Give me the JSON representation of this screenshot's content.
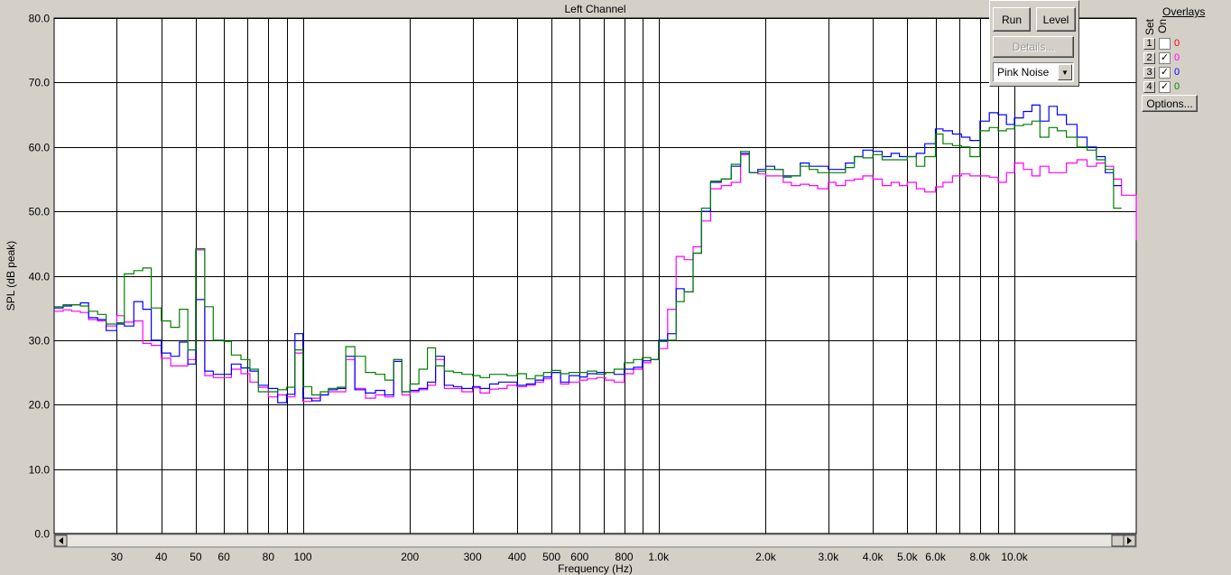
{
  "chart_data": {
    "type": "line",
    "title": "Left Channel",
    "xlabel": "Frequency (Hz)",
    "ylabel": "SPL (dB peak)",
    "x_scale": "log",
    "xlim": [
      20,
      22000
    ],
    "ylim": [
      0,
      80
    ],
    "y_ticks": [
      0,
      10,
      20,
      30,
      40,
      50,
      60,
      70,
      80
    ],
    "y_tick_labels": [
      "0.0",
      "10.0",
      "20.0",
      "30.0",
      "40.0",
      "50.0",
      "60.0",
      "70.0",
      "80.0"
    ],
    "x_ticks": [
      30,
      40,
      50,
      60,
      80,
      100,
      200,
      300,
      400,
      500,
      600,
      800,
      1000,
      2000,
      3000,
      4000,
      5000,
      6000,
      8000,
      10000
    ],
    "x_tick_labels": [
      "30",
      "40",
      "50",
      "60",
      "80",
      "100",
      "200",
      "300",
      "400",
      "500",
      "600",
      "800",
      "1.0k",
      "2.0k",
      "3.0k",
      "4.0k",
      "5.0k",
      "6.0k",
      "8.0k",
      "10.0k"
    ],
    "x_grid": [
      30,
      40,
      50,
      60,
      70,
      80,
      90,
      100,
      200,
      300,
      400,
      500,
      600,
      700,
      800,
      900,
      1000,
      2000,
      3000,
      4000,
      5000,
      6000,
      7000,
      8000,
      9000,
      10000
    ],
    "grid": true,
    "bands_hz": [
      20,
      21.2,
      22.4,
      23.7,
      25,
      26.5,
      28,
      30,
      31.5,
      33.5,
      35.5,
      37.5,
      40,
      42.5,
      45,
      47.5,
      50,
      53,
      56,
      60,
      63,
      67,
      71,
      75,
      80,
      85,
      90,
      95,
      100,
      106,
      112,
      118,
      125,
      132,
      140,
      150,
      160,
      170,
      180,
      190,
      200,
      212,
      224,
      236,
      250,
      265,
      280,
      300,
      315,
      335,
      355,
      375,
      400,
      425,
      450,
      475,
      500,
      530,
      560,
      600,
      630,
      670,
      710,
      750,
      800,
      850,
      900,
      950,
      1000,
      1060,
      1120,
      1180,
      1250,
      1320,
      1400,
      1500,
      1600,
      1700,
      1800,
      1900,
      2000,
      2120,
      2240,
      2360,
      2500,
      2650,
      2800,
      3000,
      3150,
      3350,
      3550,
      3750,
      4000,
      4250,
      4500,
      4750,
      5000,
      5300,
      5600,
      6000,
      6300,
      6700,
      7100,
      7500,
      8000,
      8500,
      9000,
      9500,
      10000,
      10600,
      11200,
      11800,
      12500,
      13200,
      14000,
      15000,
      16000,
      17000,
      18000,
      19000,
      20000,
      22000
    ],
    "series": [
      {
        "overlay": "2",
        "color": "#ff00ff",
        "values": [
          34.5,
          34.7,
          34.5,
          34.3,
          33.2,
          33,
          32.2,
          33.8,
          32.8,
          33,
          29.5,
          29.2,
          27.2,
          26,
          26,
          27,
          44,
          24.5,
          24.2,
          24.2,
          25.5,
          24.8,
          23.5,
          22.7,
          21.2,
          21.5,
          21.2,
          28,
          20.5,
          21,
          21.5,
          22,
          22,
          27,
          22.5,
          21,
          21.5,
          21.2,
          27,
          21.5,
          22,
          22.3,
          23,
          27,
          22.5,
          22.5,
          22,
          22.6,
          21.8,
          22.4,
          22.5,
          23,
          22.8,
          23,
          23.5,
          24,
          25,
          23.2,
          23.5,
          23.8,
          24,
          24.2,
          23.8,
          23.5,
          24.8,
          25.5,
          26.5,
          27,
          28.7,
          34.8,
          43,
          42.5,
          44.5,
          48.5,
          53.5,
          54,
          54.5,
          58.8,
          56,
          55.8,
          55.5,
          55.5,
          54.5,
          54,
          54.2,
          54,
          53.5,
          54.5,
          54,
          54.8,
          55,
          55.5,
          55,
          54,
          54.5,
          54,
          54.5,
          53.5,
          53,
          53.8,
          54.5,
          55.5,
          55.8,
          55.5,
          55.5,
          55.3,
          54.5,
          56,
          57.5,
          56.5,
          55.5,
          57,
          56,
          56,
          57.5,
          58,
          57,
          57.5,
          57,
          55,
          52.5,
          45.5
        ]
      },
      {
        "overlay": "3",
        "color": "#0000ff",
        "values": [
          35,
          35.3,
          35.5,
          35.8,
          33.5,
          33.2,
          31.5,
          32.5,
          32.2,
          36,
          34.8,
          30,
          28,
          27.5,
          29.7,
          26.3,
          36.3,
          25.2,
          24.7,
          24.7,
          26.3,
          25.7,
          25.2,
          23,
          22.5,
          20.3,
          21.6,
          31,
          21,
          20.6,
          21.5,
          22.3,
          22.5,
          27.5,
          22.3,
          21.8,
          22.2,
          21.5,
          26.7,
          22,
          22.2,
          22.5,
          23.5,
          27.5,
          23,
          22.8,
          22.5,
          22.8,
          22.5,
          23.2,
          23.5,
          23.5,
          23,
          23.2,
          23.8,
          24.3,
          25,
          23.5,
          24.5,
          24.3,
          24.8,
          25,
          25,
          24.7,
          25.5,
          25.8,
          26.8,
          27,
          30,
          31,
          38,
          37.5,
          43.5,
          50,
          54.5,
          55,
          57,
          59,
          56,
          56.5,
          57,
          56.5,
          55.5,
          55.5,
          57.5,
          57,
          57,
          56.5,
          56.5,
          57.5,
          58.5,
          59.5,
          59.3,
          58.5,
          59,
          58.5,
          58.5,
          59,
          60.5,
          62.8,
          62.5,
          62,
          61.5,
          61,
          64,
          65.3,
          65,
          63.5,
          64.5,
          65.5,
          66.5,
          64,
          66.3,
          65,
          63.5,
          61.5,
          60,
          58.5,
          56,
          54
        ]
      },
      {
        "overlay": "4",
        "color": "#008000",
        "values": [
          35.2,
          35.5,
          35.5,
          35.3,
          34.5,
          34,
          32.5,
          32.7,
          40.3,
          40.8,
          41.2,
          35,
          33,
          32,
          34.8,
          28.5,
          44.2,
          35.2,
          30,
          29.8,
          27.7,
          27,
          25.5,
          22,
          22,
          22.3,
          22.7,
          28.5,
          22.8,
          21.5,
          22,
          22.5,
          22.7,
          29,
          27.5,
          25,
          24.7,
          23.8,
          27,
          22,
          23.2,
          25.5,
          28.8,
          26,
          25.2,
          25,
          24.7,
          24.5,
          24.2,
          24.7,
          24.7,
          24.5,
          24.8,
          24,
          24.5,
          25,
          25.3,
          24.8,
          25,
          25,
          25.2,
          24.7,
          25,
          25.5,
          26.5,
          27,
          27.3,
          27,
          29.8,
          30,
          36,
          37.5,
          43.5,
          50.5,
          54.7,
          55,
          57.3,
          59.3,
          56,
          56.2,
          56.5,
          56.5,
          55.3,
          55.5,
          57,
          56.5,
          56,
          56,
          56,
          56.8,
          58.5,
          58.3,
          58.8,
          58,
          58,
          58,
          58.5,
          57,
          58.5,
          62,
          60.5,
          60.2,
          60,
          58.5,
          62.5,
          63,
          62.5,
          62.8,
          63.3,
          63.5,
          64,
          61.5,
          63,
          62.5,
          61.5,
          60,
          59.5,
          58,
          56.5,
          50.5
        ]
      }
    ]
  },
  "controls": {
    "run_label": "Run",
    "level_label": "Level",
    "details_label": "Details...",
    "source_value": "Pink Noise",
    "options_label": "Options..."
  },
  "overlays": {
    "title": "Overlays",
    "set_header": "Set",
    "on_header": "On",
    "rows": [
      {
        "set": "1",
        "checked": false,
        "value": "0",
        "color": "#ff0000"
      },
      {
        "set": "2",
        "checked": true,
        "value": "0",
        "color": "#ff00ff"
      },
      {
        "set": "3",
        "checked": true,
        "value": "0",
        "color": "#0000ff"
      },
      {
        "set": "4",
        "checked": true,
        "value": "0",
        "color": "#008000"
      }
    ]
  }
}
